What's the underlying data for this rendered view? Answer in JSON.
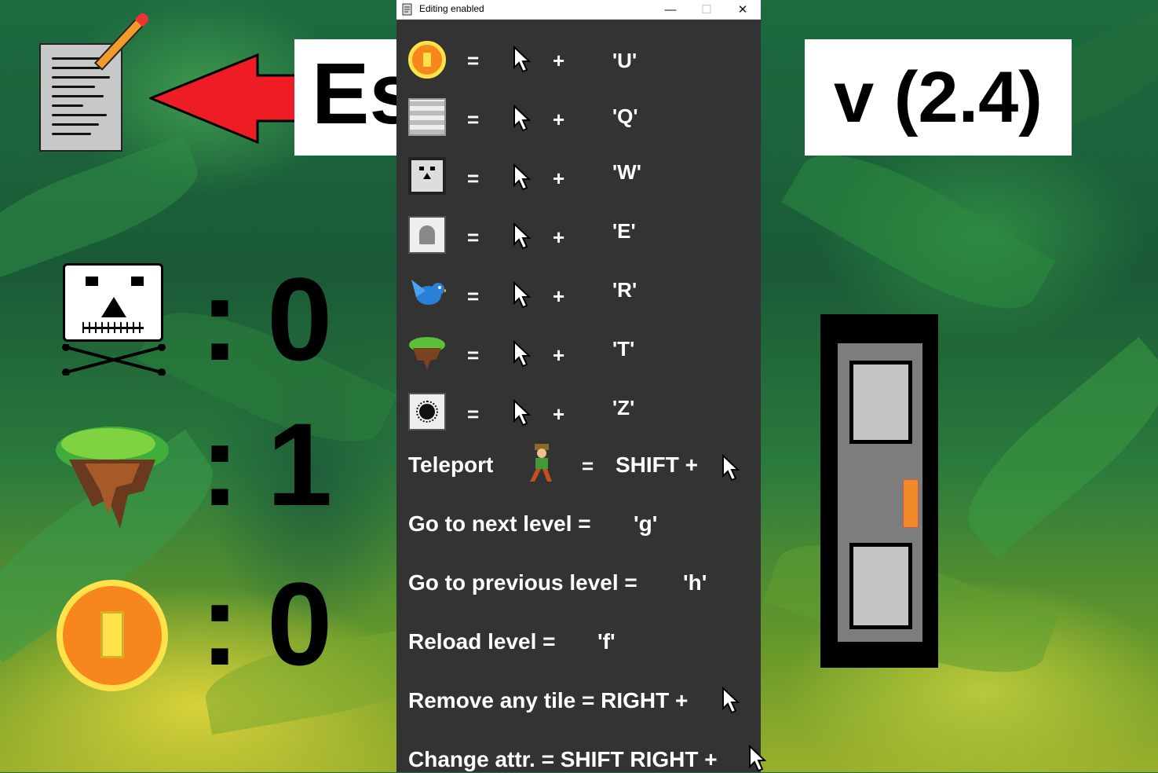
{
  "dialog": {
    "title": "Editing enabled",
    "window_buttons": {
      "minimize": "—",
      "maximize": "☐",
      "close": "✕"
    },
    "bindings": [
      {
        "tile": "coin-tile",
        "equals": "=",
        "plus": "+",
        "key": "'U'"
      },
      {
        "tile": "stone-tile",
        "equals": "=",
        "plus": "+",
        "key": "'Q'"
      },
      {
        "tile": "skull-tile",
        "equals": "=",
        "plus": "+",
        "key": "'W'"
      },
      {
        "tile": "ghost-tile",
        "equals": "=",
        "plus": "+",
        "key": "'E'"
      },
      {
        "tile": "bird-tile",
        "equals": "=",
        "plus": "+",
        "key": "'R'"
      },
      {
        "tile": "island-tile",
        "equals": "=",
        "plus": "+",
        "key": "'T'"
      },
      {
        "tile": "spikeball-tile",
        "equals": "=",
        "plus": "+",
        "key": "'Z'"
      }
    ],
    "teleport": {
      "label": "Teleport",
      "equals": "=",
      "combo": "SHIFT +"
    },
    "next_level": {
      "label": "Go to next level =",
      "key": "'g'"
    },
    "prev_level": {
      "label": "Go to previous level =",
      "key": "'h'"
    },
    "reload_level": {
      "label": "Reload level =",
      "key": "'f'"
    },
    "remove_tile": {
      "label": "Remove any tile = RIGHT +"
    },
    "change_attr": {
      "label": "Change attr. = SHIFT RIGHT +"
    }
  },
  "hud": {
    "esc_label": "Esc",
    "version": "v (2.4)",
    "counters": [
      {
        "icon": "skull-icon",
        "colon": ":",
        "value": "0"
      },
      {
        "icon": "island-icon",
        "colon": ":",
        "value": "1"
      },
      {
        "icon": "coin-icon",
        "colon": ":",
        "value": "0"
      }
    ]
  },
  "colors": {
    "dialog_bg": "#333333",
    "arrow_red": "#ee1c24",
    "coin_orange": "#f7861d",
    "coin_yellow": "#ffe14a",
    "door_gray": "#7d7d7d"
  }
}
